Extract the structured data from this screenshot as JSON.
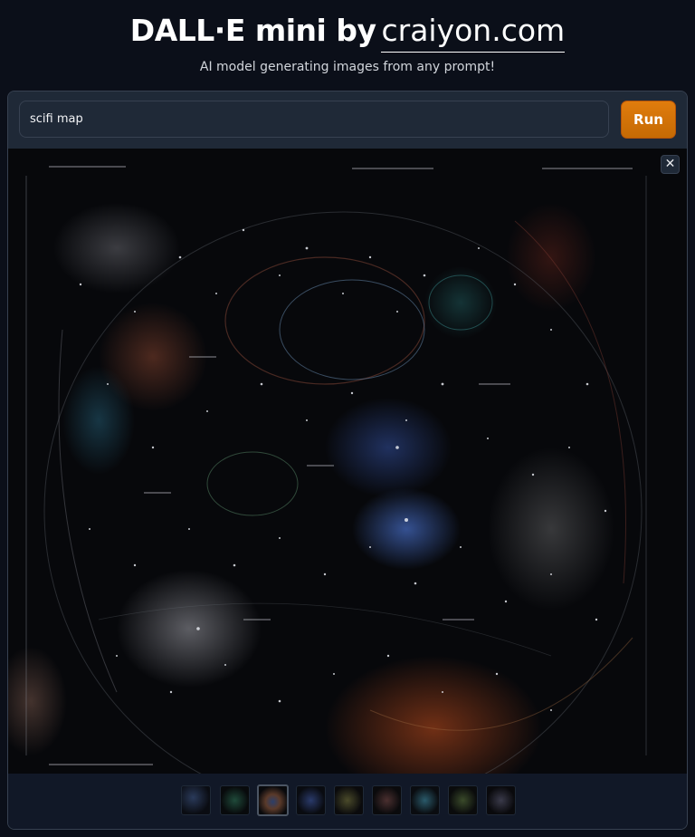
{
  "header": {
    "title_main": "DALL·E mini by",
    "title_link": "craiyon.com",
    "subtitle": "AI model generating images from any prompt!"
  },
  "prompt": {
    "value": "scifi map",
    "run_label": "Run"
  },
  "gallery": {
    "close_glyph": "✕",
    "selected_index": 2,
    "thumbnail_count": 9
  },
  "colors": {
    "page_background": "#0b0f19",
    "panel_background": "#1f2937",
    "accent": "#d97706"
  }
}
